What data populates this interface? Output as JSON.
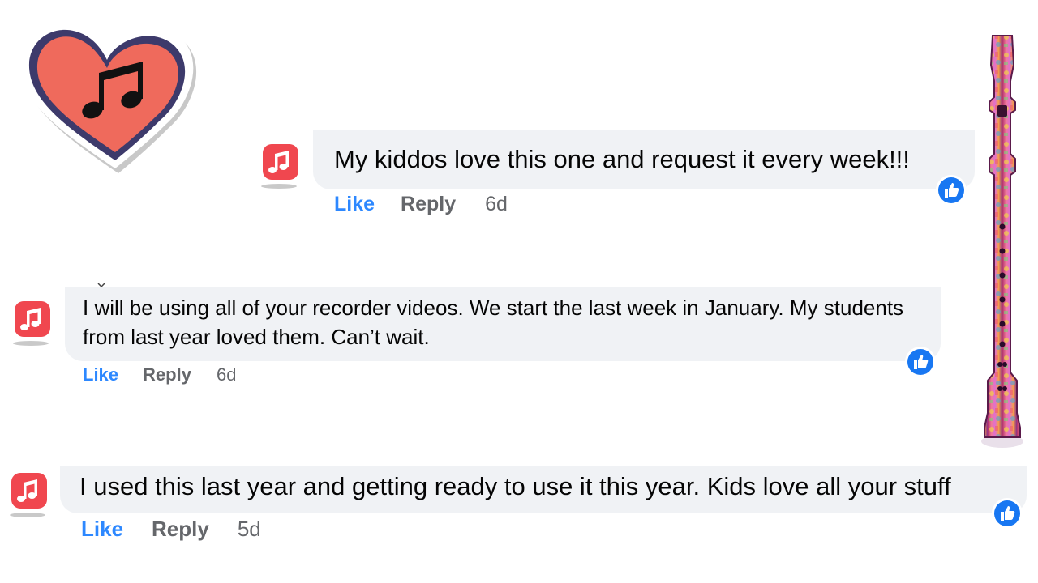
{
  "comments": [
    {
      "text": "My kiddos love this one and request it every week!!!",
      "like_label": "Like",
      "reply_label": "Reply",
      "time": "6d",
      "icon": "music-app-icon",
      "reaction": "thumbs-up-icon"
    },
    {
      "text": "I will be using all of your recorder videos. We start the last week in January. My students from last year loved them. Can’t wait.",
      "like_label": "Like",
      "reply_label": "Reply",
      "time": "6d",
      "icon": "music-app-icon",
      "reaction": "thumbs-up-icon"
    },
    {
      "text": "I used this last year and getting ready to use it this year. Kids love all your stuff",
      "like_label": "Like",
      "reply_label": "Reply",
      "time": "5d",
      "icon": "music-app-icon",
      "reaction": "thumbs-up-icon"
    }
  ],
  "decorations": {
    "heart": "heart-music-note-sticker",
    "recorder": "recorder-instrument"
  },
  "colors": {
    "bubble_bg": "#f0f2f5",
    "like_blue": "#2d88ff",
    "meta_gray": "#65676b",
    "heart_fill": "#ef6a5c",
    "heart_outline": "#3d3a6b",
    "app_icon_red": "#f0474f"
  }
}
